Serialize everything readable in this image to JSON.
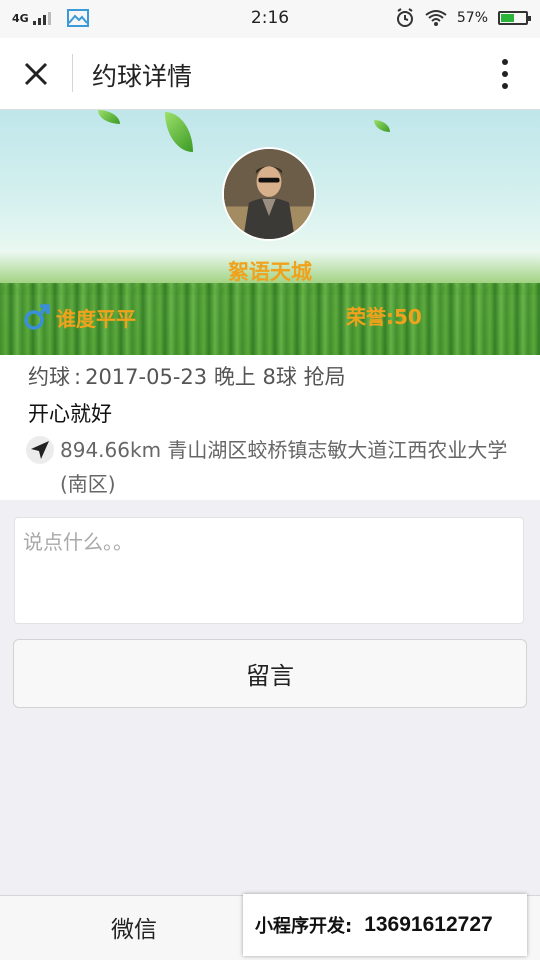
{
  "status_bar": {
    "network": "4G",
    "time": "2:16",
    "battery_percent": "57%",
    "battery_level": 0.57,
    "icons": [
      "signal-icon",
      "gallery-icon",
      "alarm-icon",
      "wifi-icon",
      "battery-icon"
    ]
  },
  "nav": {
    "title": "约球详情",
    "close_icon": "close-icon",
    "more_icon": "more-vertical-icon"
  },
  "profile": {
    "nickname": "絮语天城",
    "skill_level": "谁度平平",
    "honor": "荣誉:50",
    "gender_icon": "male-icon"
  },
  "match": {
    "label": "约球",
    "colon": ":",
    "date": "2017-05-23",
    "time_of_day": "晚上",
    "ball_type": "8球",
    "mode": "抢局",
    "note": "开心就好",
    "distance": "894.66km",
    "address": "青山湖区蛟桥镇志敏大道江西农业大学(南区)",
    "location_icon": "location-arrow-icon"
  },
  "comment": {
    "placeholder": "说点什么。。",
    "value": "",
    "submit_label": "留言"
  },
  "bottom": {
    "wechat_label": "微信",
    "promo_label": "小程序开发:",
    "promo_phone": "13691612727"
  },
  "colors": {
    "accent": "#f0a21c",
    "gender_icon": "#3a8fd8",
    "battery": "#2bb43a"
  }
}
